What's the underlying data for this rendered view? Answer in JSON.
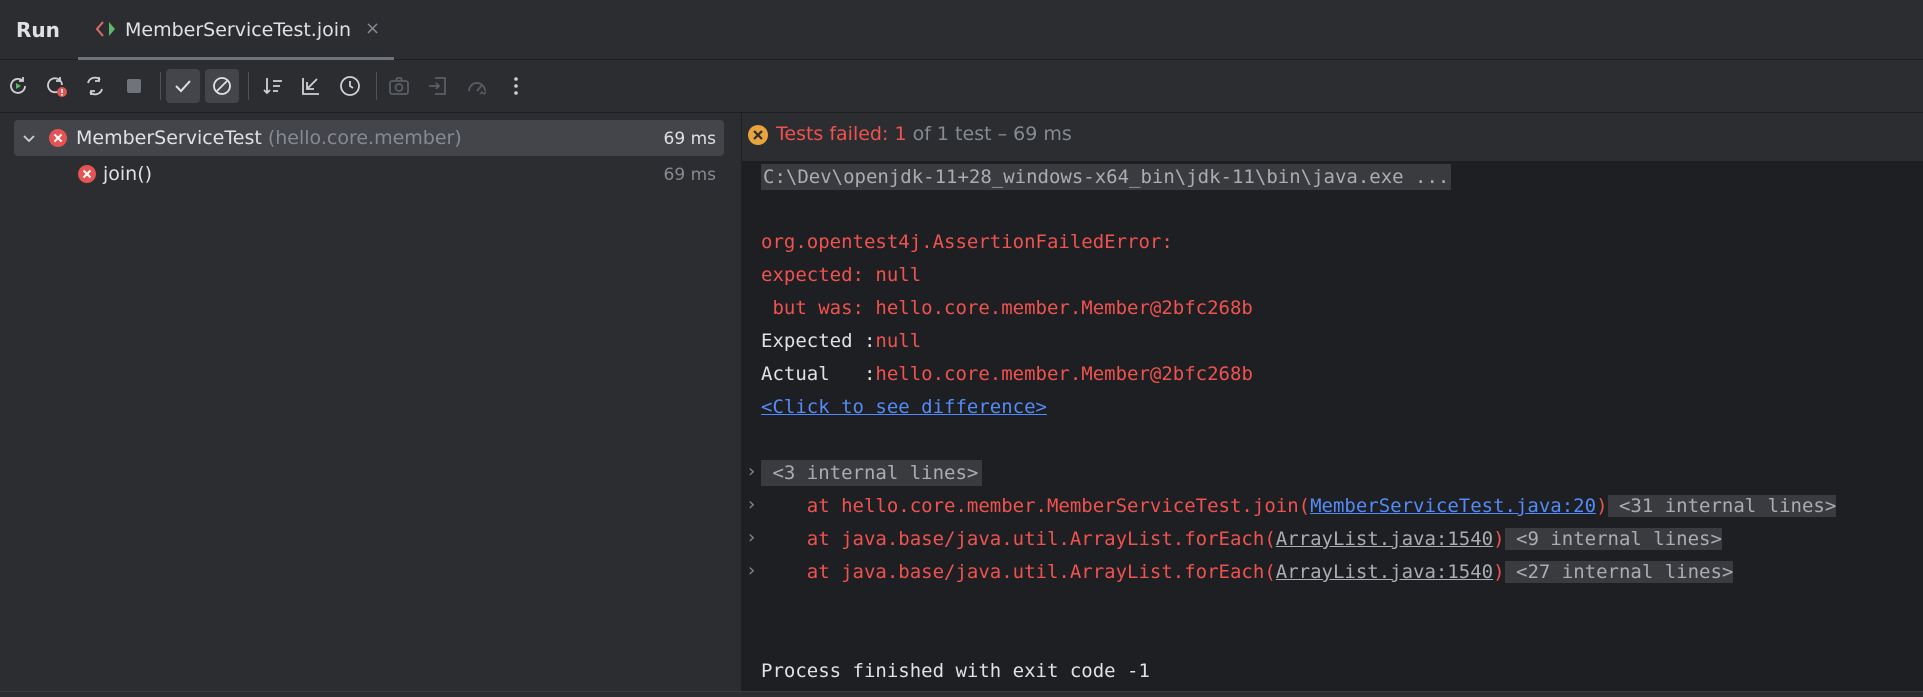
{
  "tabbar": {
    "run_label": "Run",
    "tab_title": "MemberServiceTest.join",
    "close_glyph": "×"
  },
  "toolbar": {
    "icons": [
      "rerun-icon",
      "rerun-failed-icon",
      "toggle-auto-test-icon",
      "stop-icon",
      "show-passed-icon",
      "show-ignored-icon",
      "sort-icon",
      "collapse-icon",
      "history-icon",
      "screenshot-icon",
      "import-icon",
      "coverage-icon",
      "more-icon"
    ],
    "active": [
      "show-passed-icon",
      "show-ignored-icon"
    ]
  },
  "tree": {
    "items": [
      {
        "name": "MemberServiceTest",
        "package": "(hello.core.member)",
        "time": "69 ms",
        "status": "failed",
        "expanded": true
      },
      {
        "name": "join()",
        "package": "",
        "time": "69 ms",
        "status": "failed"
      }
    ]
  },
  "status": {
    "prefix": "Tests failed: ",
    "count": "1",
    "suffix": " of 1 test – 69 ms"
  },
  "console": {
    "cmd": "C:\\Dev\\openjdk-11+28_windows-x64_bin\\jdk-11\\bin\\java.exe ...",
    "error_class": "org.opentest4j.AssertionFailedError:",
    "expected_line": "expected: null",
    "but_was_line": " but was: hello.core.member.Member@2bfc268b",
    "expected_label": "Expected :",
    "expected_value": "null",
    "actual_label": "Actual   :",
    "actual_value": "hello.core.member.Member@2bfc268b",
    "diff_link": "<Click to see difference>",
    "internal_first": " <3 internal lines>",
    "stack": [
      {
        "prefix": "    at hello.core.member.MemberServiceTest.join(",
        "link": "MemberServiceTest.java:20",
        "suffix": ")",
        "internal": " <31 internal lines>"
      },
      {
        "prefix": "    at java.base/java.util.ArrayList.forEach(",
        "link": "ArrayList.java:1540",
        "suffix": ")",
        "internal": " <9 internal lines>"
      },
      {
        "prefix": "    at java.base/java.util.ArrayList.forEach(",
        "link": "ArrayList.java:1540",
        "suffix": ")",
        "internal": " <27 internal lines>"
      }
    ],
    "exit_line": "Process finished with exit code -1"
  },
  "colors": {
    "error_red": "#f0524f",
    "link_blue": "#548af7",
    "console_bg": "#1e1f22",
    "panel_bg": "#2b2d30"
  }
}
